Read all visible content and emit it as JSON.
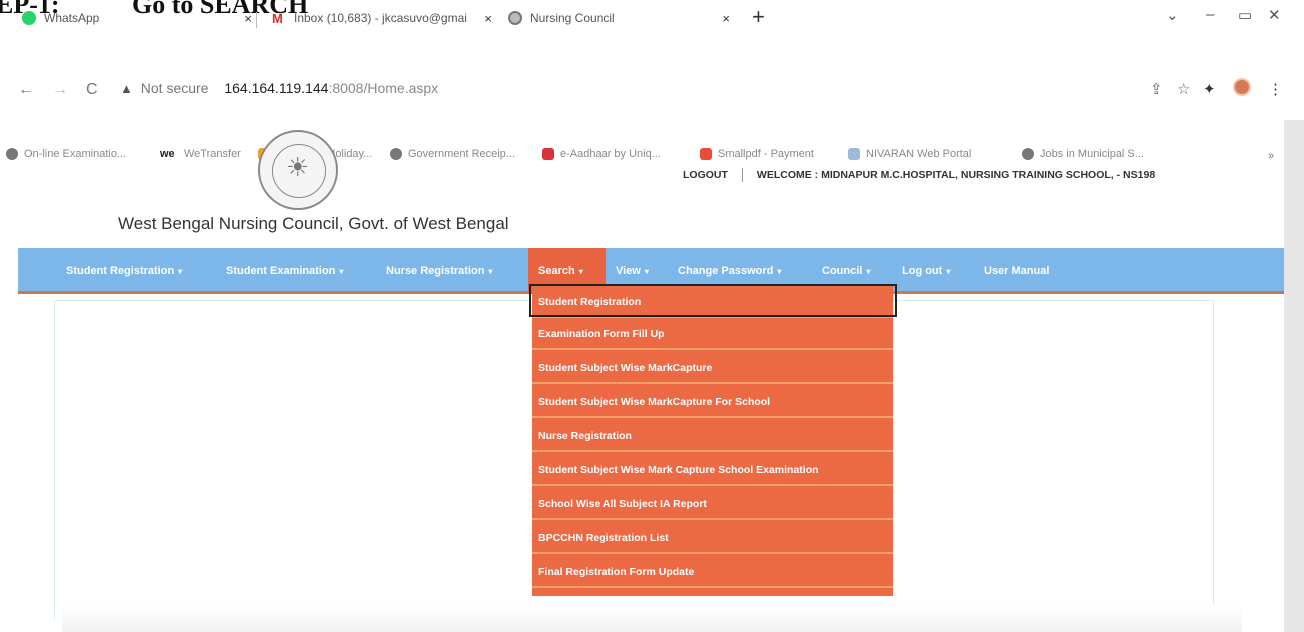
{
  "doc_heading": {
    "step": "EP-1:",
    "title": "Go to SEARCH"
  },
  "browser": {
    "tabs": [
      {
        "title": "WhatsApp",
        "close": "×",
        "color": "#25d366"
      },
      {
        "title": "Inbox (10,683) - jkcasuvo@gmai",
        "close": "×",
        "color": "#d93025",
        "glyph": "M"
      },
      {
        "title": "Nursing Council",
        "close": "×",
        "color": "#777777"
      }
    ],
    "new_tab": "+",
    "window_controls": [
      "⌄",
      "–",
      "▭",
      "✕"
    ],
    "nav": {
      "back": "←",
      "forward": "→",
      "reload": "C"
    },
    "url": {
      "warning_icon": "▲",
      "not_secure": "Not secure",
      "host": "164.164.119.144",
      "path": ":8008/Home.aspx"
    },
    "toolbar_icons": [
      "share-icon",
      "star-icon",
      "extensions-icon",
      "side-panel-icon",
      "profile-icon",
      "menu-icon"
    ],
    "bookmarks": [
      {
        "label": "On-line Examinatio...",
        "color": "#777777"
      },
      {
        "label": "WeTransfer",
        "color": "#222222",
        "glyph": "we"
      },
      {
        "label": "Additional Holiday...",
        "color": "#f0a030"
      },
      {
        "label": "Government Receip...",
        "color": "#777777"
      },
      {
        "label": "e-Aadhaar by Uniq...",
        "color": "#d9323a"
      },
      {
        "label": "Smallpdf - Payment",
        "color": "#e94c3c"
      },
      {
        "label": "NIVARAN Web Portal",
        "color": "#9bbbd9"
      },
      {
        "label": "Jobs in Municipal S...",
        "color": "#777777"
      }
    ],
    "bookmarks_more": "»"
  },
  "header": {
    "site_title": "West Bengal Nursing Council, Govt. of West Bengal",
    "logout_link": "LOGOUT",
    "welcome": "WELCOME : MIDNAPUR M.C.HOSPITAL, NURSING TRAINING SCHOOL, - NS198"
  },
  "navbar": {
    "items": [
      {
        "label": "Student Registration",
        "caret": "▾"
      },
      {
        "label": "Student Examination",
        "caret": "▾"
      },
      {
        "label": "Nurse Registration",
        "caret": "▾"
      },
      {
        "label": "Search",
        "caret": "▾"
      },
      {
        "label": "View",
        "caret": "▾"
      },
      {
        "label": "Change Password",
        "caret": "▾"
      },
      {
        "label": "Council",
        "caret": "▾"
      },
      {
        "label": "Log out",
        "caret": "▾"
      },
      {
        "label": "User Manual",
        "caret": ""
      }
    ],
    "active": "Search"
  },
  "search_menu": {
    "items": [
      "Student Registration",
      "Examination Form Fill Up",
      "Student Subject Wise MarkCapture",
      "Student Subject Wise MarkCapture For School",
      "Nurse Registration",
      "Student Subject Wise Mark Capture School Examination",
      "School Wise All Subject IA Report",
      "BPCCHN Registration List",
      "Final Registration Form Update"
    ],
    "highlighted": "Student Registration"
  },
  "colors": {
    "navbar": "#7db7ea",
    "active_menu": "#e8633f",
    "dropdown": "#eb6a44",
    "dropdown_divider": "#f2a06a"
  }
}
